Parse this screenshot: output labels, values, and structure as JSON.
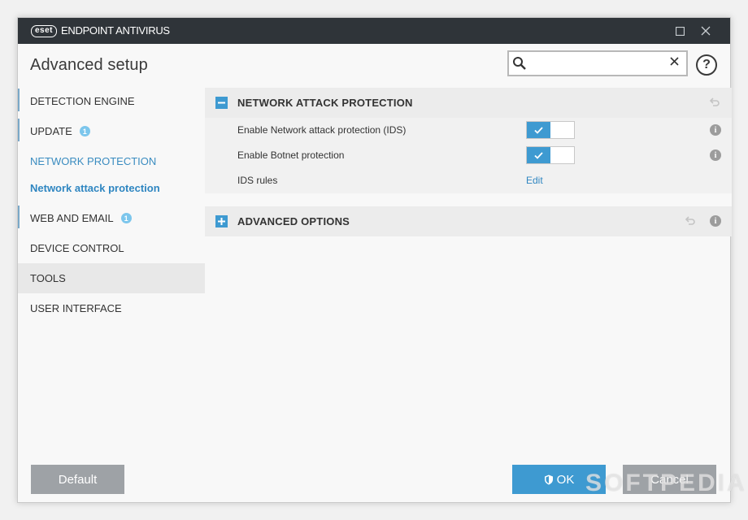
{
  "titlebar": {
    "logo": "eset",
    "product": "ENDPOINT ANTIVIRUS"
  },
  "header": {
    "title": "Advanced setup",
    "search_value": "",
    "search_placeholder": "",
    "help_label": "?"
  },
  "sidebar": {
    "items": [
      {
        "label": "DETECTION ENGINE"
      },
      {
        "label": "UPDATE",
        "badge": "1"
      },
      {
        "label": "NETWORK PROTECTION"
      },
      {
        "label": "Network attack protection"
      },
      {
        "label": "WEB AND EMAIL",
        "badge": "1"
      },
      {
        "label": "DEVICE CONTROL"
      },
      {
        "label": "TOOLS"
      },
      {
        "label": "USER INTERFACE"
      }
    ]
  },
  "sections": {
    "network_attack": {
      "title": "NETWORK ATTACK PROTECTION",
      "expanded": true,
      "rows": [
        {
          "label": "Enable Network attack protection (IDS)",
          "enabled": true
        },
        {
          "label": "Enable Botnet protection",
          "enabled": true
        },
        {
          "label": "IDS rules",
          "action": "Edit"
        }
      ]
    },
    "advanced": {
      "title": "ADVANCED OPTIONS",
      "expanded": false
    }
  },
  "footer": {
    "default_label": "Default",
    "ok_label": "OK",
    "cancel_label": "Cancel"
  },
  "watermark": "SOFTPEDIA",
  "colors": {
    "accent": "#3e9ad1",
    "titlebar": "#2f3439",
    "button_gray": "#9ea2a6"
  }
}
